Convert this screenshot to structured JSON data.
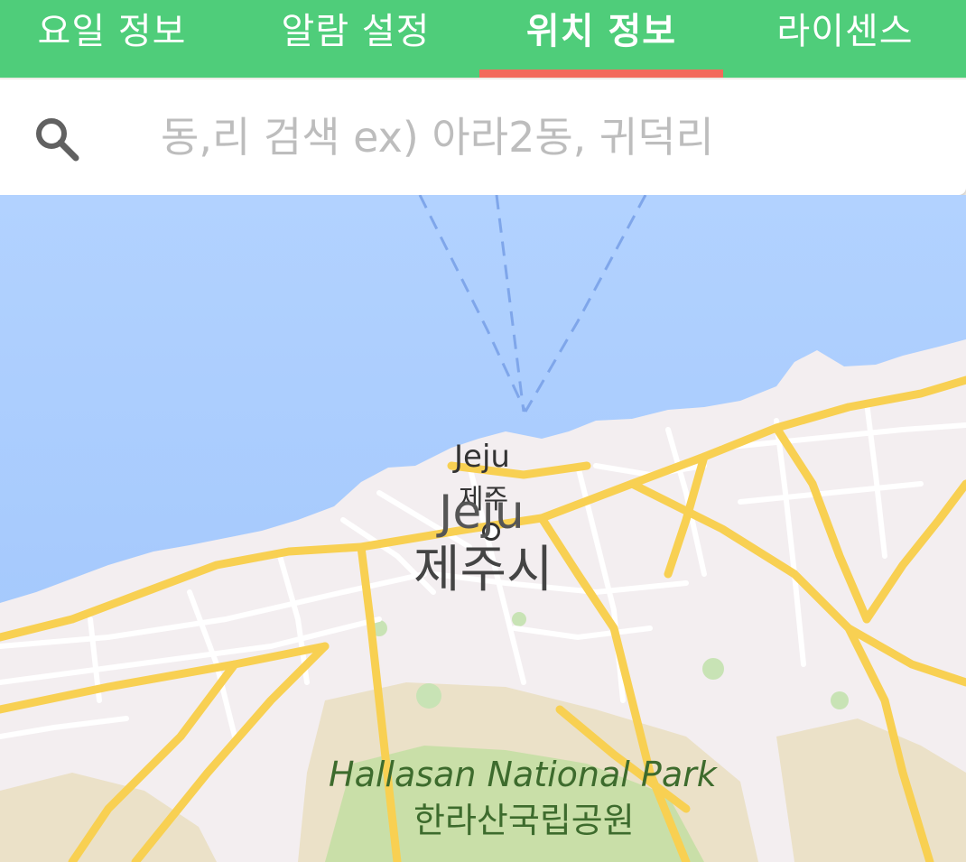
{
  "tabs": [
    {
      "label": "요일 정보",
      "active": false
    },
    {
      "label": "알람 설정",
      "active": false
    },
    {
      "label": "위치 정보",
      "active": true
    },
    {
      "label": "라이센스",
      "active": false
    }
  ],
  "search": {
    "icon": "search-icon",
    "placeholder": "동,리 검색 ex) 아라2동, 귀덕리",
    "value": ""
  },
  "map": {
    "labels": {
      "pin_en": "Jeju",
      "pin_ko": "제주",
      "city_en": "Jeju",
      "city_ko": "제주시",
      "park_en": "Hallasan National Park",
      "park_ko": "한라산국립공원"
    }
  },
  "colors": {
    "tab_bar": "#4fcd7a",
    "tab_indicator": "#f36a5a",
    "sea": "#aacbff",
    "land": "#f2efe9",
    "major_road": "#f8d052",
    "park": "#c9dfa8",
    "park_label": "#3d6b2d"
  }
}
